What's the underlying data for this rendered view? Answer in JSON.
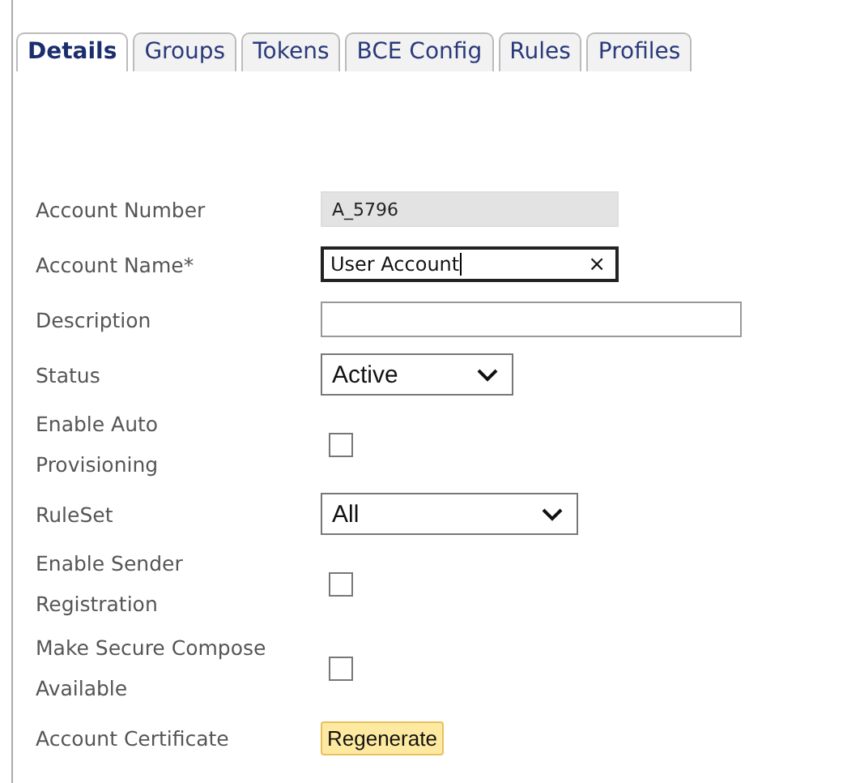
{
  "tabs": [
    {
      "label": "Details",
      "selected": true
    },
    {
      "label": "Groups",
      "selected": false
    },
    {
      "label": "Tokens",
      "selected": false
    },
    {
      "label": "BCE Config",
      "selected": false
    },
    {
      "label": "Rules",
      "selected": false
    },
    {
      "label": "Profiles",
      "selected": false
    }
  ],
  "fields": [
    {
      "kind": "readonly",
      "label": "Account Number",
      "value": "A_5796"
    },
    {
      "kind": "text",
      "label": "Account Name*",
      "value": "User Account",
      "clear": "×",
      "focused": true
    },
    {
      "kind": "text",
      "label": "Description",
      "focused": false
    },
    {
      "kind": "select",
      "label": "Status",
      "value": "Active"
    },
    {
      "kind": "checkbox",
      "label": "Enable Auto Provisioning",
      "checked": false
    },
    {
      "kind": "select",
      "label": "RuleSet",
      "value": "All"
    },
    {
      "kind": "checkbox",
      "label": "Enable Sender Registration",
      "checked": false
    },
    {
      "kind": "checkbox",
      "label": "Make Secure Compose Available",
      "checked": false
    },
    {
      "kind": "button",
      "label": "Account Certificate",
      "value": "Regenerate"
    }
  ]
}
